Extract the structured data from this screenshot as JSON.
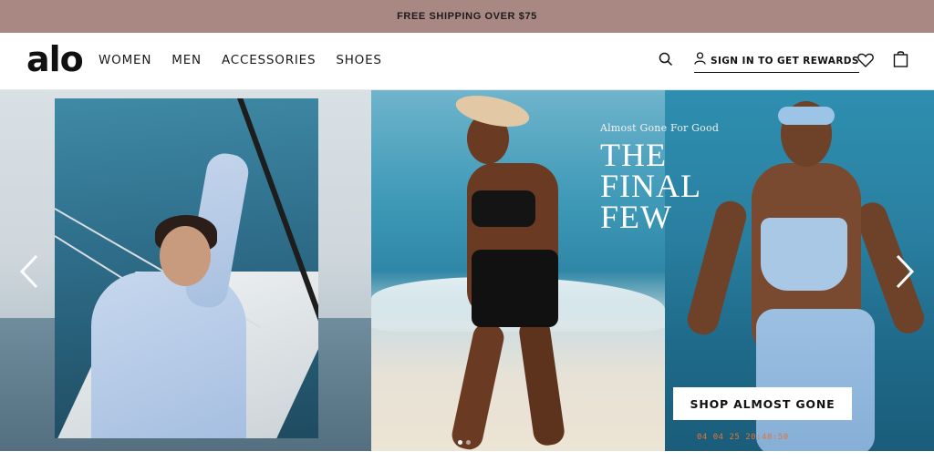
{
  "promo": {
    "text": "FREE SHIPPING OVER $75"
  },
  "header": {
    "logo": "alo",
    "nav": [
      "WOMEN",
      "MEN",
      "ACCESSORIES",
      "SHOES"
    ],
    "rewards_label": "SIGN IN TO GET REWARDS",
    "icons": [
      "search-icon",
      "user-icon",
      "heart-icon",
      "bag-icon"
    ]
  },
  "hero": {
    "kicker": "Almost Gone For Good",
    "headline": [
      "THE",
      "FINAL",
      "FEW"
    ],
    "cta_label": "SHOP ALMOST GONE",
    "date_stamp": "04 04 25  20:48:50",
    "slides": 3,
    "active_slide": 1
  },
  "colors": {
    "promo_bg": "#a98883",
    "text_dark": "#111111",
    "date_stamp": "#e0743a"
  }
}
